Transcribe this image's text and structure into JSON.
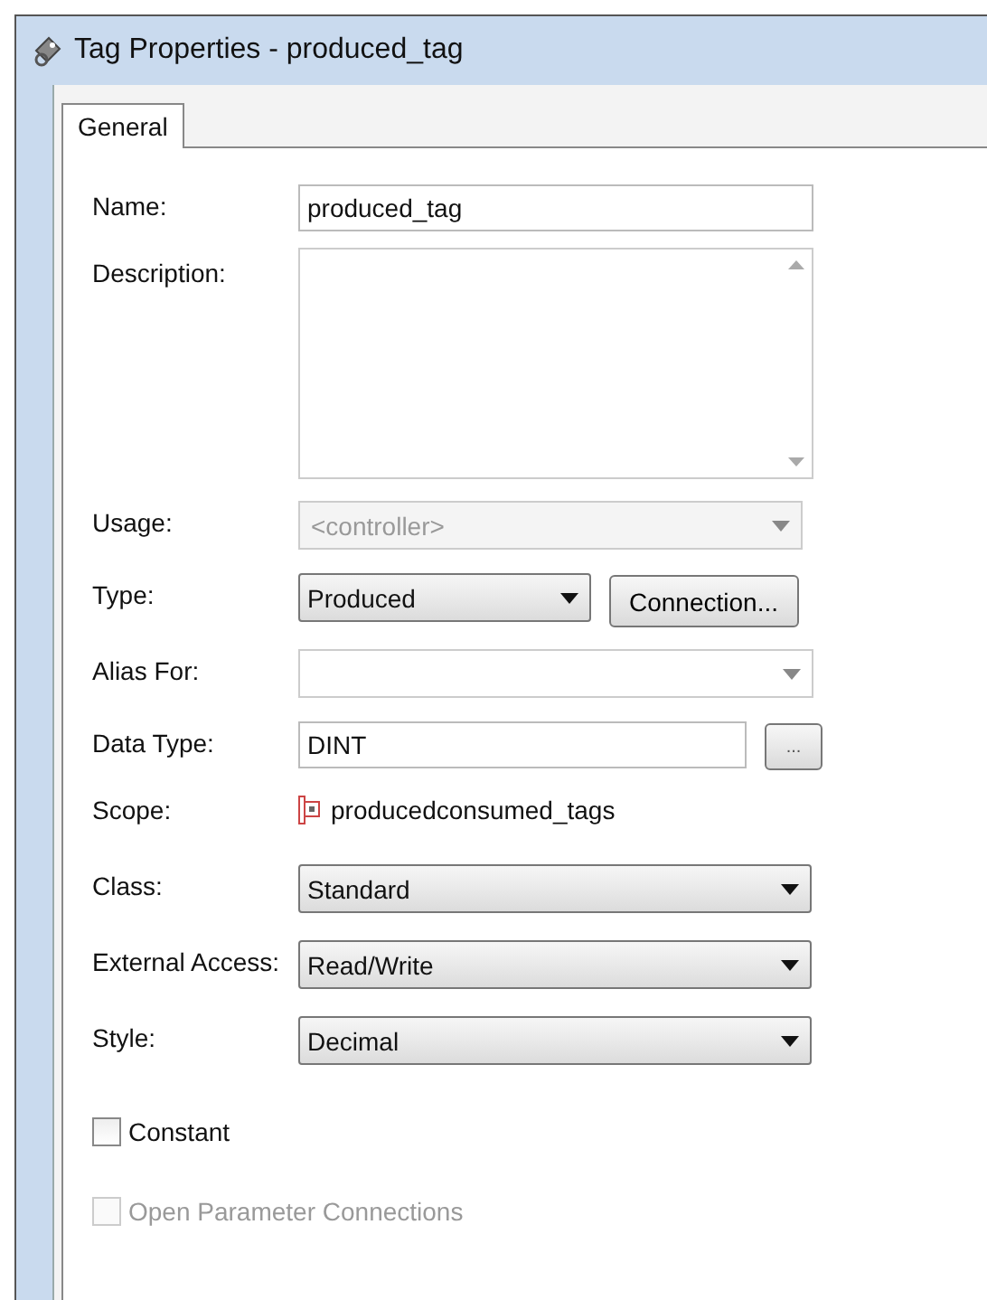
{
  "window": {
    "title": "Tag Properties - produced_tag"
  },
  "tabs": [
    {
      "label": "General",
      "selected": true
    }
  ],
  "fields": [
    {
      "label": "Name:",
      "kind": "text",
      "value": "produced_tag"
    },
    {
      "label": "Description:",
      "kind": "textarea"
    },
    {
      "label": "Usage:",
      "kind": "combo",
      "value": "<controller>",
      "disabled": true
    },
    {
      "label": "Type:",
      "kind": "dropdown",
      "value": "Produced",
      "button": "Connection..."
    },
    {
      "label": "Alias For:",
      "kind": "combo",
      "disabled": false
    },
    {
      "label": "Data Type:",
      "kind": "text",
      "value": "DINT",
      "button": "..."
    },
    {
      "label": "Scope:",
      "kind": "scope",
      "value": "producedconsumed_tags"
    },
    {
      "label": "Class:",
      "kind": "dropdown",
      "value": "Standard"
    },
    {
      "label": "External Access:",
      "kind": "dropdown",
      "value": "Read/Write"
    },
    {
      "label": "Style:",
      "kind": "dropdown",
      "value": "Decimal"
    }
  ],
  "checkboxes": [
    {
      "label": "Constant",
      "checked": false,
      "disabled": false
    },
    {
      "label": "Open Parameter Connections",
      "checked": false,
      "disabled": true
    }
  ]
}
